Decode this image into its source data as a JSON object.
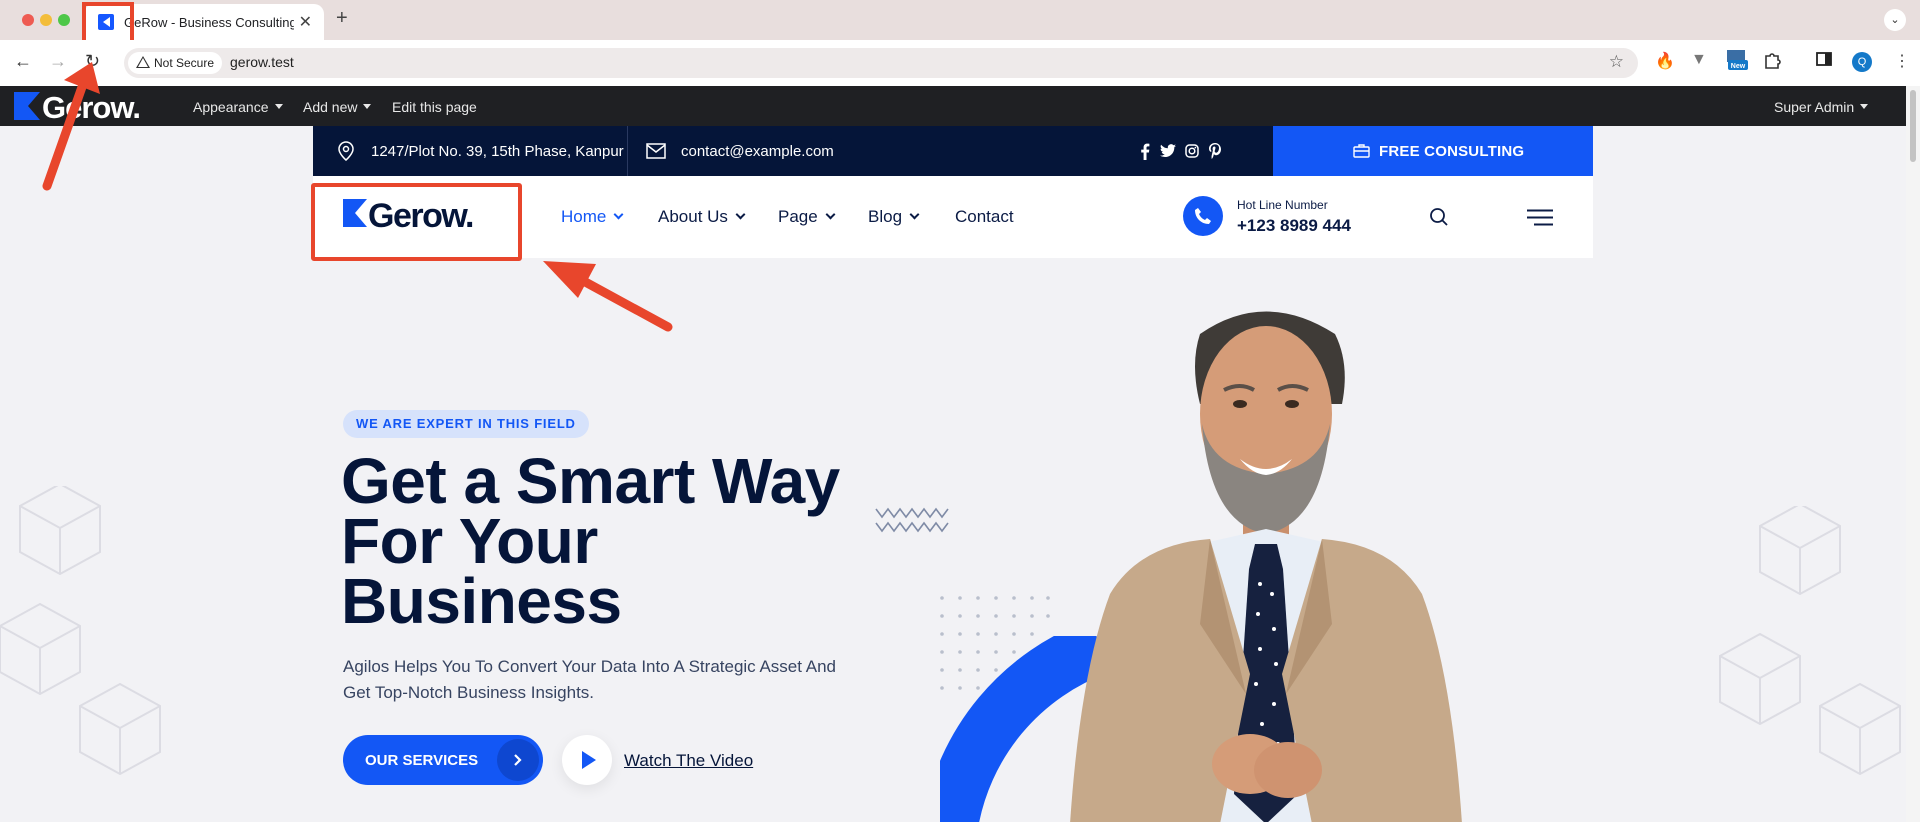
{
  "browser": {
    "tab_title": "GeRow - Business Consulting",
    "new_tab_symbol": "+",
    "close_symbol": "✕",
    "tab_menu_symbol": "⌄",
    "security_label": "Not Secure",
    "url": "gerow.test",
    "back_symbol": "←",
    "forward_symbol": "→",
    "reload_symbol": "↻",
    "star_symbol": "☆",
    "extensions": [
      "flame-extension-icon",
      "vee-extension-icon",
      "new-badge-extension-icon",
      "puzzle-extensions-icon",
      "sidepanel-icon",
      "profile-avatar",
      "kebab-menu-icon"
    ],
    "profile_initial": "Q",
    "ext_new_badge": "New",
    "menu_symbol": "⋮"
  },
  "admin_bar": {
    "logo_text": "Gerow.",
    "items": [
      "Appearance",
      "Add new",
      "Edit this page"
    ],
    "user": "Super Admin"
  },
  "topbar": {
    "address": "1247/Plot No. 39, 15th Phase, Kanpur",
    "email": "contact@example.com",
    "cta": "FREE CONSULTING"
  },
  "header": {
    "logo_text": "Gerow.",
    "menu": [
      "Home",
      "About Us",
      "Page",
      "Blog",
      "Contact"
    ],
    "hotline_label": "Hot Line Number",
    "hotline_number": "+123 8989 444"
  },
  "hero": {
    "tagline": "WE ARE EXPERT IN THIS FIELD",
    "title_lines": [
      "Get a Smart Way",
      "For Your",
      "Business"
    ],
    "subtitle": "Agilos Helps You To Convert Your Data Into A Strategic Asset And Get Top-Notch Business Insights.",
    "services_button": "OUR SERVICES",
    "video_link": "Watch The Video"
  },
  "colors": {
    "brand_blue": "#1357f5",
    "navy": "#051539",
    "annotation_red": "#e8462c"
  }
}
